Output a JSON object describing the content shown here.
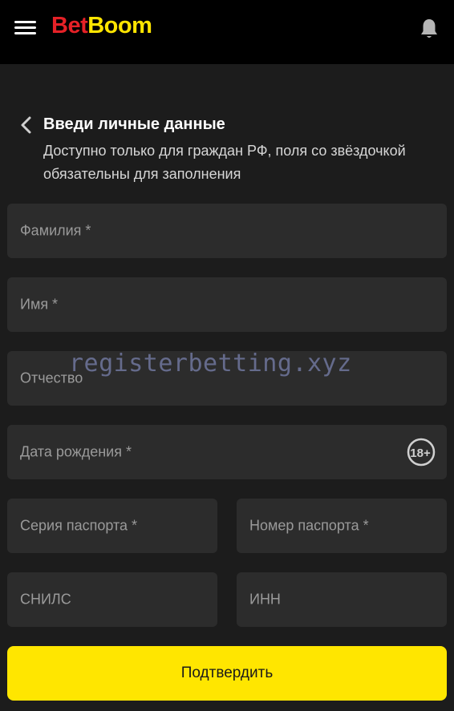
{
  "header": {
    "logo_part1": "Bet",
    "logo_part2": "Boom",
    "menu_icon": "hamburger-menu-icon",
    "notification_icon": "bell-icon"
  },
  "form": {
    "title": "Введи личные данные",
    "subtitle": "Доступно только для граждан РФ, поля со звёздочкой обязательны для заполнения",
    "fields": {
      "last_name": "Фамилия *",
      "first_name": "Имя *",
      "patronymic": "Отчество",
      "birth_date": "Дата рождения *",
      "passport_series": "Серия паспорта *",
      "passport_number": "Номер паспорта *",
      "snils": "СНИЛС",
      "inn": "ИНН"
    },
    "age_badge": "18+",
    "submit_label": "Подтвердить"
  },
  "watermark": "registerbetting.xyz",
  "colors": {
    "background": "#1c1c1c",
    "header_bg": "#000000",
    "field_bg": "#2c2c2c",
    "accent_yellow": "#ffe600",
    "logo_red": "#e52127"
  }
}
